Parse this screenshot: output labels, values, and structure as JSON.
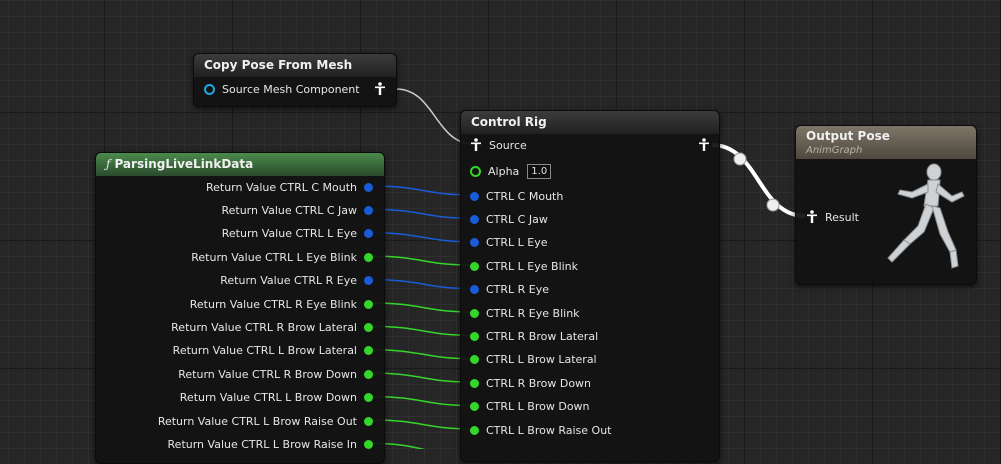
{
  "nodes": {
    "copy_pose": {
      "title": "Copy Pose From Mesh",
      "pin": "Source Mesh Component"
    },
    "parsing": {
      "title": "ParsingLiveLinkData",
      "icon": "function-icon",
      "outputs": [
        {
          "label": "Return Value CTRL C Mouth",
          "type": "blue"
        },
        {
          "label": "Return Value CTRL C Jaw",
          "type": "blue"
        },
        {
          "label": "Return Value CTRL L Eye",
          "type": "blue"
        },
        {
          "label": "Return Value CTRL L Eye Blink",
          "type": "green"
        },
        {
          "label": "Return Value CTRL R Eye",
          "type": "blue"
        },
        {
          "label": "Return Value CTRL R Eye Blink",
          "type": "green"
        },
        {
          "label": "Return Value CTRL R Brow Lateral",
          "type": "green"
        },
        {
          "label": "Return Value CTRL L Brow Lateral",
          "type": "green"
        },
        {
          "label": "Return Value CTRL R Brow Down",
          "type": "green"
        },
        {
          "label": "Return Value CTRL L Brow Down",
          "type": "green"
        },
        {
          "label": "Return Value CTRL L Brow Raise Out",
          "type": "green"
        },
        {
          "label": "Return Value CTRL L Brow Raise In",
          "type": "green"
        }
      ]
    },
    "control_rig": {
      "title": "Control Rig",
      "source": "Source",
      "alpha_label": "Alpha",
      "alpha_value": "1.0",
      "inputs": [
        {
          "label": "CTRL C Mouth",
          "type": "blue"
        },
        {
          "label": "CTRL C Jaw",
          "type": "blue"
        },
        {
          "label": "CTRL L Eye",
          "type": "blue"
        },
        {
          "label": "CTRL L Eye Blink",
          "type": "green"
        },
        {
          "label": "CTRL R Eye",
          "type": "blue"
        },
        {
          "label": "CTRL R Eye Blink",
          "type": "green"
        },
        {
          "label": "CTRL R Brow Lateral",
          "type": "green"
        },
        {
          "label": "CTRL L Brow Lateral",
          "type": "green"
        },
        {
          "label": "CTRL R Brow Down",
          "type": "green"
        },
        {
          "label": "CTRL L Brow Down",
          "type": "green"
        },
        {
          "label": "CTRL L Brow Raise Out",
          "type": "green"
        }
      ]
    },
    "output_pose": {
      "title": "Output Pose",
      "subtitle": "AnimGraph",
      "pin": "Result"
    }
  },
  "colors": {
    "float_pin": "#35d62a",
    "struct_pin": "#1a5cd8",
    "object_pin": "#1ea6e8",
    "pose_wire": "#ffffff"
  }
}
